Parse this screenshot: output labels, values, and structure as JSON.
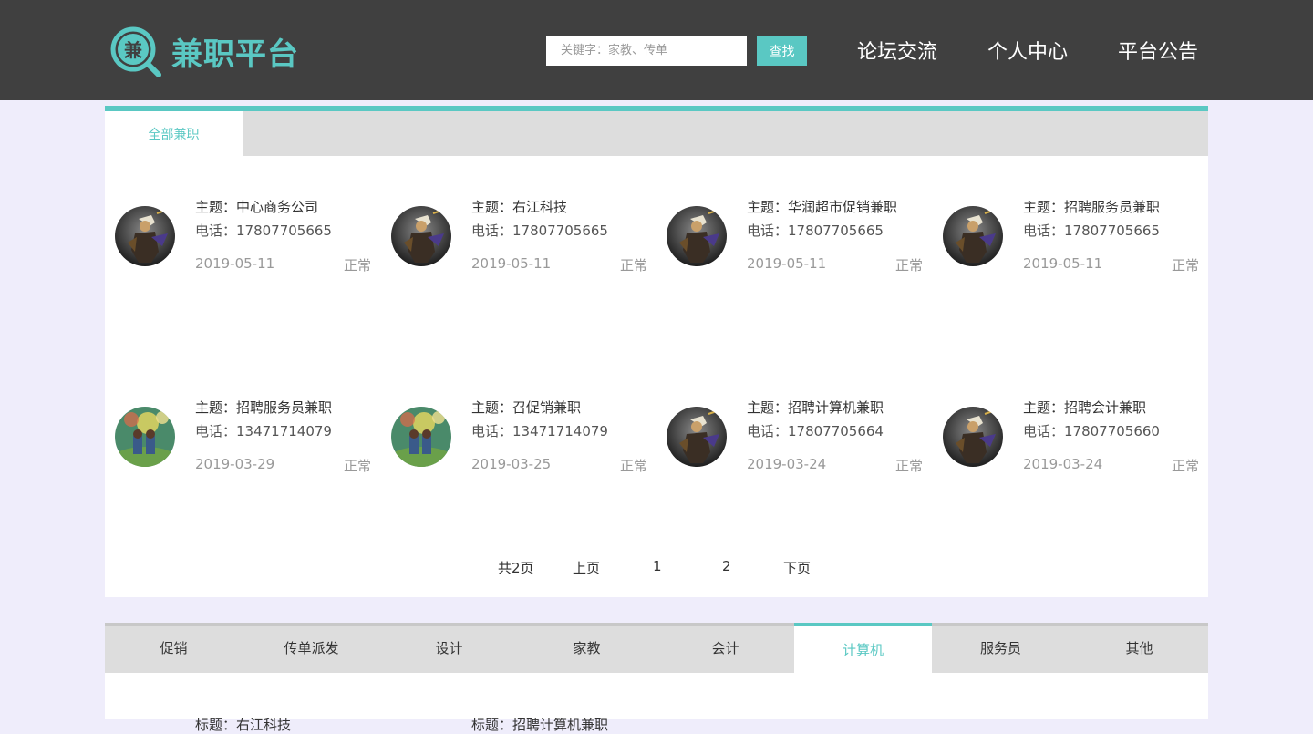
{
  "header": {
    "logo_text": "兼职平台",
    "logo_glyph": "兼",
    "search_placeholder": "关键字：家教、传单",
    "search_button": "查找",
    "nav": [
      "论坛交流",
      "个人中心",
      "平台公告"
    ]
  },
  "colors": {
    "accent": "#5ac8c3",
    "header_bg": "#404040",
    "page_bg": "#efedfb",
    "tab_bg": "#dddddd"
  },
  "main_tab": "全部兼职",
  "jobs": [
    {
      "title": "主题：中心商务公司",
      "phone": "电话：17807705665",
      "date": "2019-05-11",
      "status": "正常",
      "avatar": "warrior-avatar-icon"
    },
    {
      "title": "主题：右江科技",
      "phone": "电话：17807705665",
      "date": "2019-05-11",
      "status": "正常",
      "avatar": "warrior-avatar-icon"
    },
    {
      "title": "主题：华润超市促销兼职",
      "phone": "电话：17807705665",
      "date": "2019-05-11",
      "status": "正常",
      "avatar": "warrior-avatar-icon"
    },
    {
      "title": "主题：招聘服务员兼职",
      "phone": "电话：17807705665",
      "date": "2019-05-11",
      "status": "正常",
      "avatar": "warrior-avatar-icon"
    },
    {
      "title": "主题：招聘服务员兼职",
      "phone": "电话：13471714079",
      "date": "2019-03-29",
      "status": "正常",
      "avatar": "fireworks-avatar-icon"
    },
    {
      "title": "主题：召促销兼职",
      "phone": "电话：13471714079",
      "date": "2019-03-25",
      "status": "正常",
      "avatar": "fireworks-avatar-icon"
    },
    {
      "title": "主题：招聘计算机兼职",
      "phone": "电话：17807705664",
      "date": "2019-03-24",
      "status": "正常",
      "avatar": "warrior-avatar-icon"
    },
    {
      "title": "主题：招聘会计兼职",
      "phone": "电话：17807705660",
      "date": "2019-03-24",
      "status": "正常",
      "avatar": "warrior-avatar-icon"
    }
  ],
  "pagination": {
    "total": "共2页",
    "prev": "上页",
    "pages": [
      "1",
      "2"
    ],
    "next": "下页"
  },
  "categories": [
    "促销",
    "传单派发",
    "设计",
    "家教",
    "会计",
    "计算机",
    "服务员",
    "其他"
  ],
  "active_category": "计算机",
  "peek_titles": [
    "标题：右江科技",
    "标题：招聘计算机兼职"
  ]
}
